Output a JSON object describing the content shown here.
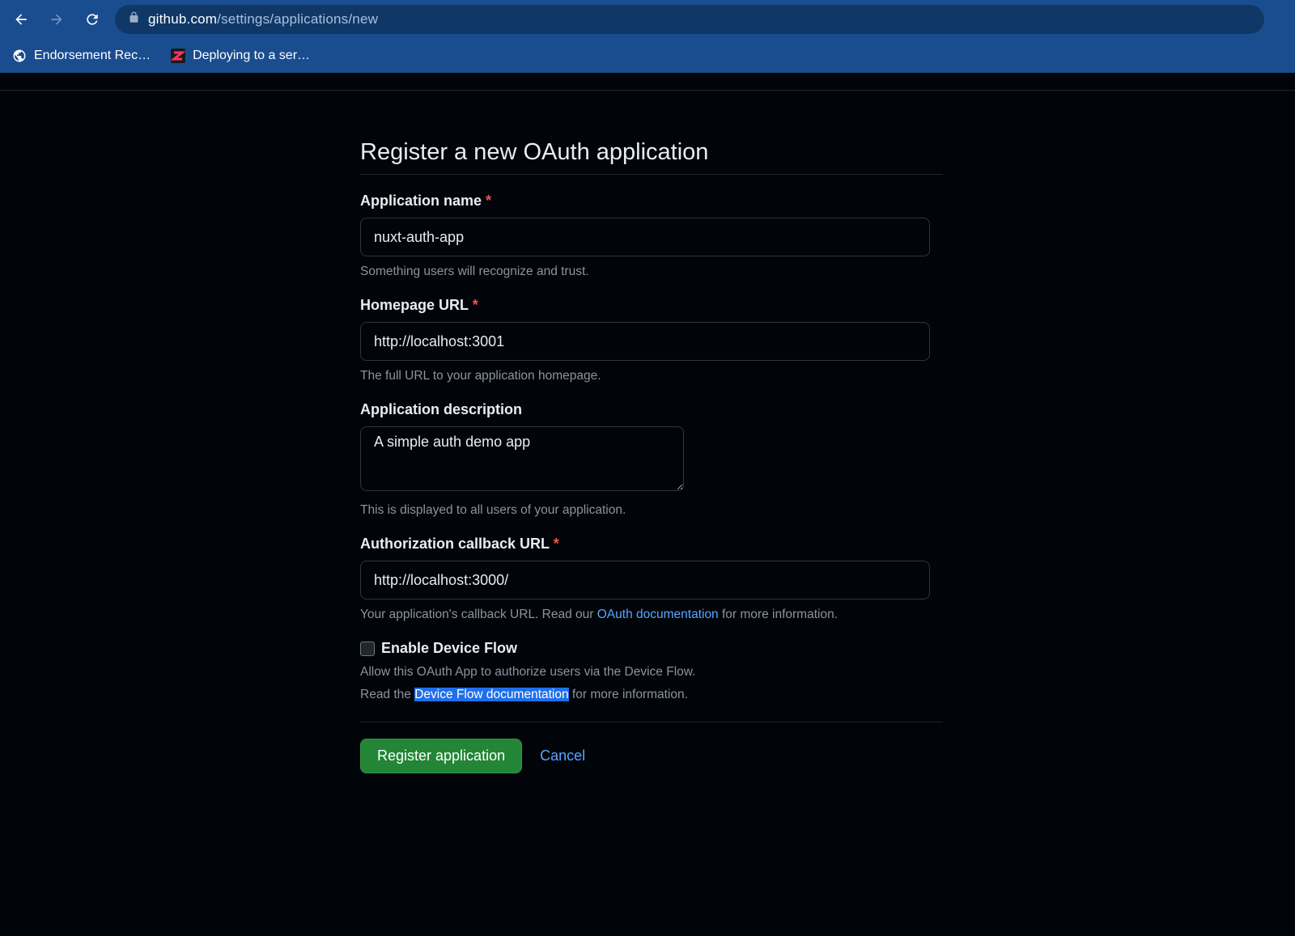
{
  "browser": {
    "url_domain": "github.com",
    "url_path": "/settings/applications/new",
    "bookmarks": [
      {
        "label": "Endorsement Rec…",
        "icon": "globe"
      },
      {
        "label": "Deploying to a ser…",
        "icon": "z"
      }
    ]
  },
  "page": {
    "title": "Register a new OAuth application"
  },
  "form": {
    "app_name": {
      "label": "Application name",
      "value": "nuxt-auth-app",
      "help": "Something users will recognize and trust."
    },
    "homepage_url": {
      "label": "Homepage URL",
      "value": "http://localhost:3001",
      "help": "The full URL to your application homepage."
    },
    "description": {
      "label": "Application description",
      "value": "A simple auth demo app",
      "help": "This is displayed to all users of your application."
    },
    "callback_url": {
      "label": "Authorization callback URL",
      "value": "http://localhost:3000/",
      "help_prefix": "Your application's callback URL. Read our ",
      "help_link": "OAuth documentation",
      "help_suffix": " for more information."
    },
    "device_flow": {
      "label": "Enable Device Flow",
      "help_line1": "Allow this OAuth App to authorize users via the Device Flow.",
      "help_line2_prefix": "Read the ",
      "help_line2_link": "Device Flow documentation",
      "help_line2_suffix": " for more information."
    },
    "buttons": {
      "submit": "Register application",
      "cancel": "Cancel"
    }
  }
}
